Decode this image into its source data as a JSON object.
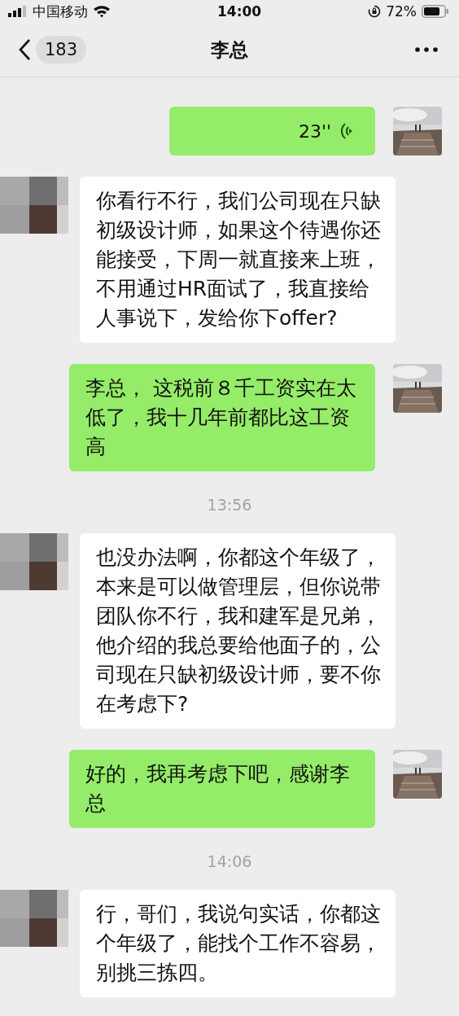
{
  "status_bar": {
    "carrier": "中国移动",
    "time": "14:00",
    "battery": "72%"
  },
  "header": {
    "unread_count": "183",
    "title": "李总"
  },
  "messages": [
    {
      "kind": "voice_sent",
      "duration": "23''"
    },
    {
      "kind": "text_received",
      "text": "你看行不行，我们公司现在只缺初级设计师，如果这个待遇你还能接受，下周一就直接来上班，不用通过HR面试了，我直接给人事说下，发给你下offer?"
    },
    {
      "kind": "text_sent",
      "text": "李总， 这税前８千工资实在太低了，我十几年前都比这工资高"
    },
    {
      "kind": "time",
      "text": "13:56"
    },
    {
      "kind": "text_received",
      "text": "也没办法啊，你都这个年级了，本来是可以做管理层，但你说带团队你不行，我和建军是兄弟，他介绍的我总要给他面子的，公司现在只缺初级设计师，要不你在考虑下?"
    },
    {
      "kind": "text_sent",
      "text": "好的，我再考虑下吧，感谢李总"
    },
    {
      "kind": "time",
      "text": "14:06"
    },
    {
      "kind": "text_received",
      "text": "行，哥们，我说句实话，你都这个年级了，能找个工作不容易，别挑三拣四。"
    }
  ]
}
